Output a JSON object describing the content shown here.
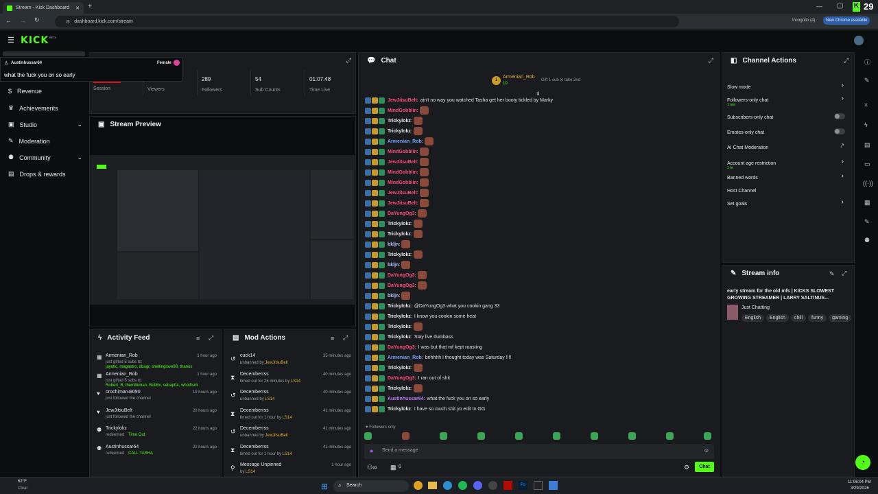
{
  "browser": {
    "tab_title": "Stream - Kick Dashboard",
    "url": "dashboard.kick.com/stream",
    "incognito": "Incognito (4)",
    "new_chrome": "New Chrome available",
    "ext_badge": "29"
  },
  "header": {
    "logo": "KICK",
    "beta": "BETA"
  },
  "popup": {
    "user": "Austinhussar64",
    "gender": "Female",
    "message": "what the fuck you on so early"
  },
  "sidebar": {
    "items": [
      "Revenue",
      "Achievements",
      "Studio",
      "Moderation",
      "Community",
      "Drops & rewards"
    ]
  },
  "stats": {
    "session_label": "Session",
    "viewers_label": "Viewers",
    "followers_value": "289",
    "followers_label": "Followers",
    "subs_value": "54",
    "subs_label": "Sub Counts",
    "time_value": "01:07:48",
    "time_label": "Time Live"
  },
  "preview": {
    "title": "Stream Preview"
  },
  "activity": {
    "title": "Activity Feed",
    "items": [
      {
        "user": "Armenian_Rob",
        "time": "1 hour ago",
        "line1": "just gifted 5 subs to:",
        "line2": "jayotic, magastro, dbagr, shellinglove98, thanos"
      },
      {
        "user": "Armenian_Rob",
        "time": "1 hour ago",
        "line1": "just gifted 5 subs to:",
        "line2": "Robert_B, them8kman, Bott6x, sebap04, whotfisml"
      },
      {
        "user": "orochimaru9090",
        "time": "19 hours ago",
        "line1": "just followed the channel",
        "line2": ""
      },
      {
        "user": "JewJitsuBelt",
        "time": "20 hours ago",
        "line1": "just followed the channel",
        "line2": ""
      },
      {
        "user": "Trickylokz",
        "time": "22 hours ago",
        "line1": "redeemed",
        "line2": "Time Out"
      },
      {
        "user": "Austinhussar64",
        "time": "22 hours ago",
        "line1": "redeemed",
        "line2": "CALL TASHA"
      }
    ]
  },
  "mod": {
    "title": "Mod Actions",
    "items": [
      {
        "user": "cuck14",
        "time": "35 minutes ago",
        "line": "unbanned by",
        "by": "JewJitsuBelt"
      },
      {
        "user": "Decemberrss",
        "time": "40 minutes ago",
        "line": "timed out for 25 minutes by",
        "by": "LS14"
      },
      {
        "user": "Decemberrss",
        "time": "40 minutes ago",
        "line": "unbanned by",
        "by": "LS14"
      },
      {
        "user": "Decemberrss",
        "time": "41 minutes ago",
        "line": "timed out for 1 hour by",
        "by": "LS14"
      },
      {
        "user": "Decemberrss",
        "time": "41 minutes ago",
        "line": "unbanned by",
        "by": "JewJitsuBelt"
      },
      {
        "user": "Decemberrss",
        "time": "41 minutes ago",
        "line": "timed out for 1 hour by",
        "by": "LS14"
      },
      {
        "user": "Message Unpinned",
        "time": "1 hour ago",
        "line": "by",
        "by": "LS14"
      }
    ]
  },
  "chat": {
    "title": "Chat",
    "pinned_user": "Armenian_Rob",
    "pinned_rank": "1",
    "pinned_count": "10",
    "pinned_note": "Gift 1 sub to take 2nd",
    "messages": [
      {
        "user": "JewJitsuBelt",
        "color": "#ff4d7a",
        "text": "ain't no way you watched Tasha get her booty tickled by Marky"
      },
      {
        "user": "MindGobblin",
        "color": "#ff4d7a",
        "text": ""
      },
      {
        "user": "Trickylokz",
        "color": "#e6e8ea",
        "text": ""
      },
      {
        "user": "Trickylokz",
        "color": "#e6e8ea",
        "text": ""
      },
      {
        "user": "Armenian_Rob",
        "color": "#7aa2ff",
        "text": ""
      },
      {
        "user": "MindGobblin",
        "color": "#ff4d7a",
        "text": ""
      },
      {
        "user": "JewJitsuBelt",
        "color": "#ff4d7a",
        "text": ""
      },
      {
        "user": "MindGobblin",
        "color": "#ff4d7a",
        "text": ""
      },
      {
        "user": "MindGobblin",
        "color": "#ff4d7a",
        "text": ""
      },
      {
        "user": "JewJitsuBelt",
        "color": "#ff4d7a",
        "text": ""
      },
      {
        "user": "JewJitsuBelt",
        "color": "#ff4d7a",
        "text": ""
      },
      {
        "user": "DaYungOg3",
        "color": "#ff4d7a",
        "text": ""
      },
      {
        "user": "Trickylokz",
        "color": "#e6e8ea",
        "text": ""
      },
      {
        "user": "Trickylokz",
        "color": "#e6e8ea",
        "text": ""
      },
      {
        "user": "bkljn",
        "color": "#b5c8ff",
        "text": ""
      },
      {
        "user": "Trickylokz",
        "color": "#e6e8ea",
        "text": ""
      },
      {
        "user": "bkljn",
        "color": "#b5c8ff",
        "text": ""
      },
      {
        "user": "DaYungOg3",
        "color": "#ff4d7a",
        "text": ""
      },
      {
        "user": "DaYungOg3",
        "color": "#ff4d7a",
        "text": ""
      },
      {
        "user": "bkljn",
        "color": "#b5c8ff",
        "text": ""
      },
      {
        "user": "Trickylokz",
        "color": "#e6e8ea",
        "text": "@DaYungOg3 what you cookin gang 33"
      },
      {
        "user": "Trickylokz",
        "color": "#e6e8ea",
        "text": "I know you cookin some heat"
      },
      {
        "user": "Trickylokz",
        "color": "#e6e8ea",
        "text": ""
      },
      {
        "user": "Trickylokz",
        "color": "#e6e8ea",
        "text": "Stay live dumbass"
      },
      {
        "user": "DaYungOg3",
        "color": "#ff4d7a",
        "text": "I was but that mf kept roasting"
      },
      {
        "user": "Armenian_Rob",
        "color": "#7aa2ff",
        "text": "brihhhh I thought today was Saturday !!!!"
      },
      {
        "user": "Trickylokz",
        "color": "#e6e8ea",
        "text": ""
      },
      {
        "user": "DaYungOg3",
        "color": "#ff4d7a",
        "text": "I ran out of shit"
      },
      {
        "user": "Trickylokz",
        "color": "#e6e8ea",
        "text": ""
      },
      {
        "user": "Austinhussar64",
        "color": "#c07cff",
        "text": "what the fuck you on so early"
      },
      {
        "user": "Trickylokz",
        "color": "#e6e8ea",
        "text": "I have so much shit yo edit tn GG"
      }
    ],
    "followers_only": "Followers only",
    "input_placeholder": "Send a message",
    "counter": "0",
    "send": "Chat"
  },
  "actions": {
    "title": "Channel Actions",
    "items": [
      {
        "label": "Slow mode",
        "sub": ""
      },
      {
        "label": "Followers-only chat",
        "sub": "1 min"
      },
      {
        "label": "Subscribers-only chat",
        "sub": ""
      },
      {
        "label": "Emotes-only chat",
        "sub": ""
      },
      {
        "label": "AI Chat Moderation",
        "sub": ""
      },
      {
        "label": "Account age restriction",
        "sub": "1 hr"
      },
      {
        "label": "Banned words",
        "sub": ""
      },
      {
        "label": "Host Channel",
        "sub": ""
      },
      {
        "label": "Set goals",
        "sub": ""
      }
    ]
  },
  "stream_info": {
    "title": "Stream info",
    "stream_title": "early stream for the old mfs | KICKS SLOWEST GROWING STREAMER | LARRY SALTINUS...",
    "category": "Just Chatting",
    "tags": [
      "English",
      "English",
      "chill",
      "funny",
      "gaming"
    ]
  },
  "taskbar": {
    "temp": "62°F",
    "weather": "Clear",
    "search": "Search",
    "time": "11:06:04 PM",
    "date": "3/29/2026"
  },
  "colors": {
    "accent": "#53fc18",
    "panel": "#191b1f",
    "bg": "#0b0e0f"
  }
}
